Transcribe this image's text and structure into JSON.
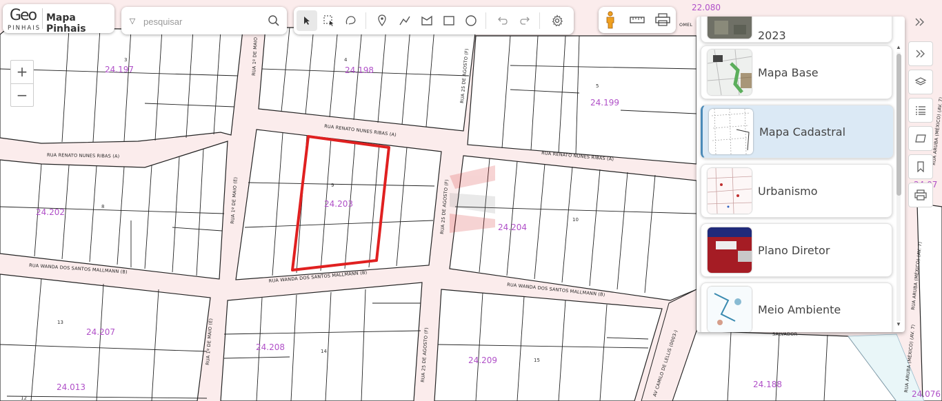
{
  "app": {
    "logo_geo": "Geo",
    "logo_pinhais": "PINHAIS",
    "title": "Mapa Pinhais"
  },
  "search": {
    "placeholder": "pesquisar",
    "value": ""
  },
  "toolbar": {
    "tools": [
      "select-pointer-icon",
      "box-select-icon",
      "lasso-select-icon",
      "marker-icon",
      "polyline-icon",
      "polygon-icon",
      "rectangle-icon",
      "circle-icon",
      "undo-icon",
      "redo-icon",
      "settings-gear-icon"
    ],
    "active_tool": "select-pointer-icon"
  },
  "view_tools": [
    "street-view-person-icon",
    "measure-ruler-icon",
    "print-layout-icon"
  ],
  "zoom": {
    "in": "+",
    "out": "−"
  },
  "map": {
    "quadras": [
      "24.197",
      "24.198",
      "24.199",
      "24.202",
      "24.203",
      "24.204",
      "24.207",
      "24.208",
      "24.209",
      "24.013",
      "24.188",
      "22.080",
      "24.07",
      "24.076"
    ],
    "lots": [
      "3",
      "4",
      "5",
      "8",
      "9",
      "10",
      "13",
      "14",
      "15",
      "12"
    ],
    "streets": [
      "RUA RENATO NUNES RIBAS (A)",
      "RUA RENATO NUNES RIBAS (A)",
      "RUA RENATO NUNES RIBAS (A)",
      "RUA WANDA DOS SANTOS MALLMANN (B)",
      "RUA WANDA DOS SANTOS MALLMANN (B)",
      "RUA WANDA DOS SANTOS MALLMANN (B)",
      "RUA 1º DE MAIO",
      "RUA 1º DE MAIO (E)",
      "RUA 1º DE MAIO (E)",
      "RUA 25 DE AGOSTO (F)",
      "RUA 25 DE AGOSTO (F)",
      "RUA 25 DE AGOSTO (F)",
      "AV CAMILO DE LELLIS (0003-)",
      "RUA ARUBA (MÉXICO) (AV. 7)",
      "RUA ARUBA (MÉXICO) (AV. 7)",
      "RUA ARUBA (MÉXICO) (AV. 7)",
      "SALVADOR",
      "OMEL"
    ],
    "highlight_color": "#e02020",
    "quadra_label_color": "#b050c8"
  },
  "layers": {
    "partial_top_label": "2023",
    "items": [
      {
        "label": "Mapa Base",
        "selected": false
      },
      {
        "label": "Mapa Cadastral",
        "selected": true
      },
      {
        "label": "Urbanismo",
        "selected": false
      },
      {
        "label": "Plano Diretor",
        "selected": false
      },
      {
        "label": "Meio Ambiente",
        "selected": false
      }
    ]
  },
  "right_rail": [
    "collapse-chevrons-icon",
    "expand-chevrons-icon",
    "layers-icon",
    "legend-list-icon",
    "area-polygon-icon",
    "bookmark-icon",
    "print-icon"
  ]
}
